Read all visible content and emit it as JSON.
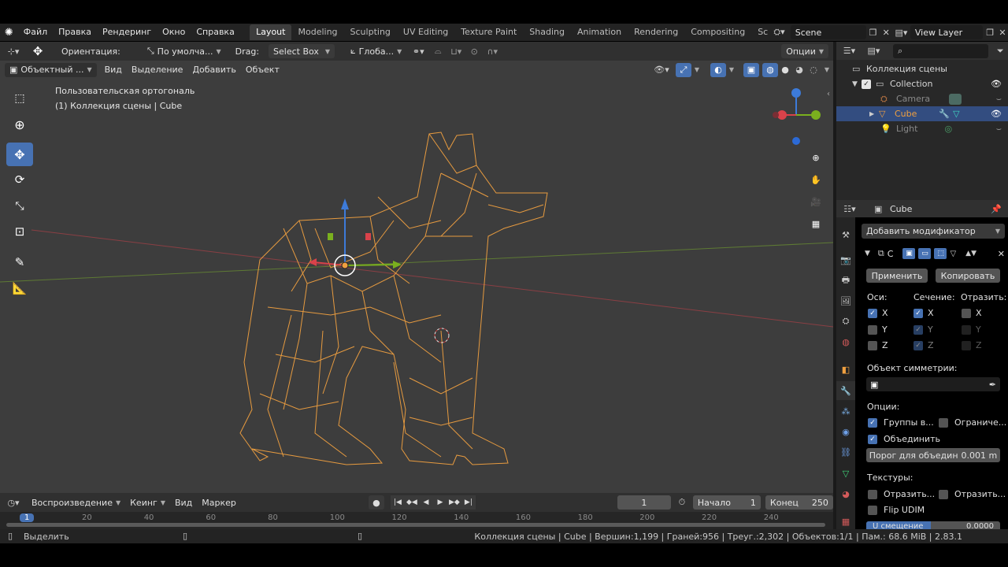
{
  "menu": {
    "items": [
      "Файл",
      "Правка",
      "Рендеринг",
      "Окно",
      "Справка"
    ]
  },
  "workspaces": [
    {
      "label": "Layout",
      "active": true
    },
    {
      "label": "Modeling"
    },
    {
      "label": "Sculpting"
    },
    {
      "label": "UV Editing"
    },
    {
      "label": "Texture Paint"
    },
    {
      "label": "Shading"
    },
    {
      "label": "Animation"
    },
    {
      "label": "Rendering"
    },
    {
      "label": "Compositing"
    },
    {
      "label": "Sc"
    }
  ],
  "scene": {
    "name": "Scene",
    "view_layer": "View Layer"
  },
  "tool_header": {
    "orientation_label": "Ориентация:",
    "orientation_value": "По умолча...",
    "drag_label": "Drag:",
    "drag_value": "Select Box",
    "pivot_value": "Глоба...",
    "options": "Опции"
  },
  "viewport_header": {
    "mode": "Объектный ...",
    "items": [
      "Вид",
      "Выделение",
      "Добавить",
      "Объект"
    ]
  },
  "viewport": {
    "view_name": "Пользовательская ортогональ",
    "collection_info": "(1) Коллекция сцены | Cube"
  },
  "outliner": {
    "search_placeholder": "",
    "root": "Коллекция сцены",
    "items": [
      {
        "label": "Collection"
      },
      {
        "label": "Camera"
      },
      {
        "label": "Cube"
      },
      {
        "label": "Light"
      }
    ]
  },
  "properties": {
    "object_name": "Cube",
    "add_modifier": "Добавить модификатор",
    "modifier_name": "С",
    "apply": "Применить",
    "copy": "Копировать",
    "axes_label": "Оси:",
    "bisect_label": "Сечение:",
    "mirror_label": "Отразить:",
    "axes": [
      "X",
      "Y",
      "Z"
    ],
    "mirror_object_label": "Объект симметрии:",
    "options_label": "Опции:",
    "vertex_groups": "Группы в...",
    "clipping": "Ограниче...",
    "merge": "Объединить",
    "merge_threshold_label": "Порог для объедин",
    "merge_threshold_value": "0.001 m",
    "textures_label": "Текстуры:",
    "flip_u": "Отразить...",
    "flip_v": "Отразить...",
    "flip_udim": "Flip UDIM",
    "offset_label": "U смещение",
    "offset_value": "0.0000"
  },
  "timeline": {
    "playback": "Воспроизведение",
    "keying": "Кеинг",
    "view": "Вид",
    "marker": "Маркер",
    "current_frame": "1",
    "start_label": "Начало",
    "start_value": "1",
    "end_label": "Конец",
    "end_value": "250",
    "ruler": [
      "1",
      "20",
      "40",
      "60",
      "80",
      "100",
      "120",
      "140",
      "160",
      "180",
      "200",
      "220",
      "240"
    ]
  },
  "status": {
    "select": "Выделить",
    "info": "Коллекция сцены | Cube | Вершин:1,199 | Граней:956 | Треуг.:2,302 | Объектов:1/1 | Пам.: 68.6 MiB | 2.83.1"
  },
  "colors": {
    "accent": "#4772b3",
    "wire": "#f0a040",
    "x_axis": "#d9424a",
    "y_axis": "#7ab01e",
    "z_axis": "#3d7bd9"
  }
}
